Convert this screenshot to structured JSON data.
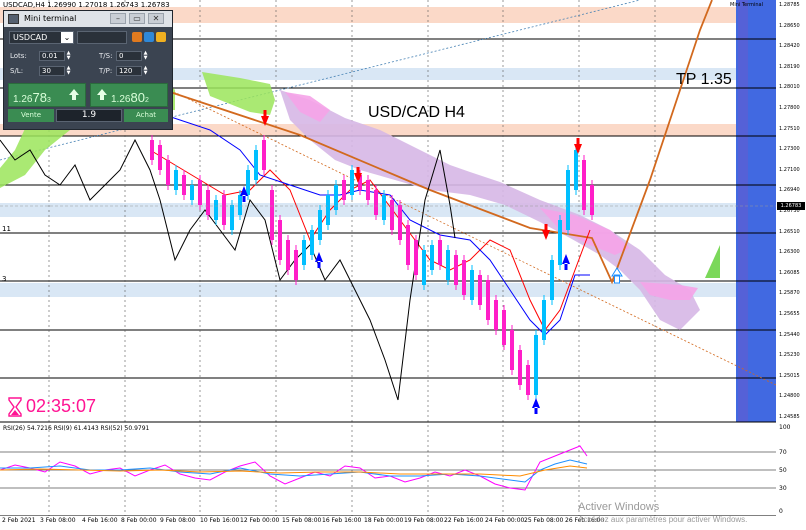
{
  "chart_header": {
    "symbol_line": "USDCAD,H4  1.26990 1.27018 1.26743 1.26783"
  },
  "chart_title": "USD/CAD H4",
  "tp_label": "TP 1.35",
  "timer": "02:35:07",
  "side_labels": [
    "11",
    "3"
  ],
  "rsi_label": "RSI(26) 54.7216   RSI(9) 61.4143   RSI(52) 50.9791",
  "top_right_label": "Mini Terminal",
  "price_axis": [
    {
      "label": "1.28785"
    },
    {
      "label": "1.28650"
    },
    {
      "label": "1.28420"
    },
    {
      "label": "1.28190"
    },
    {
      "label": "1.28010"
    },
    {
      "label": "1.27800"
    },
    {
      "label": "1.27510"
    },
    {
      "label": "1.27300"
    },
    {
      "label": "1.27100"
    },
    {
      "label": "1.26940"
    },
    {
      "label": "1.26730"
    },
    {
      "label": "1.26510"
    },
    {
      "label": "1.26300"
    },
    {
      "label": "1.26085"
    },
    {
      "label": "1.25870"
    },
    {
      "label": "1.25655"
    },
    {
      "label": "1.25440"
    },
    {
      "label": "1.25230"
    },
    {
      "label": "1.25015"
    },
    {
      "label": "1.24800"
    },
    {
      "label": "1.24585"
    }
  ],
  "current_price": "1.26783",
  "rsi_axis": [
    "100",
    "70",
    "50",
    "30",
    "0"
  ],
  "time_axis": [
    "2 Feb 2021",
    "3 Feb 08:00",
    "4 Feb 16:00",
    "8 Feb 00:00",
    "9 Feb 08:00",
    "10 Feb 16:00",
    "12 Feb 00:00",
    "15 Feb 08:00",
    "16 Feb 16:00",
    "18 Feb 00:00",
    "19 Feb 08:00",
    "22 Feb 16:00",
    "24 Feb 00:00",
    "25 Feb 08:00",
    "26 Feb 16:00"
  ],
  "watermark": {
    "title": "Activer Windows",
    "subtitle": "Accédez aux paramètres pour activer Windows."
  },
  "mini_terminal": {
    "title": "Mini terminal",
    "symbol": "USDCAD",
    "lots_label": "Lots:",
    "lots_value": "0.01",
    "ts_label": "T/S:",
    "ts_value": "0",
    "sl_label": "S/L:",
    "sl_value": "30",
    "tp_label": "T/P:",
    "tp_value": "120",
    "sell_price_small": "1.26",
    "sell_price_big": "78",
    "sell_price_sup": "3",
    "buy_price_small": "1.26",
    "buy_price_big": "80",
    "buy_price_sup": "2",
    "sell_label": "Vente",
    "buy_label": "Achat",
    "volume": "1.9"
  },
  "colors": {
    "bull_candle": "#00bfff",
    "bear_candle": "#ff1ec8",
    "kijun": "#ff0000",
    "tenkan": "#0000ff",
    "projection": "#d2691e",
    "blue_band": "#4169e1",
    "rsi_fast": "#ff00ff",
    "rsi_mid": "#1e90ff",
    "rsi_slow": "#ff8c00"
  }
}
